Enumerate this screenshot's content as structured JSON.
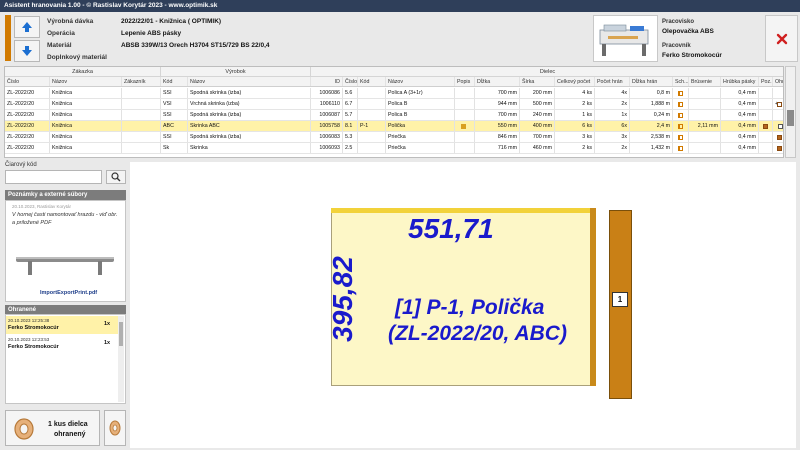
{
  "window": {
    "title": "Asistent hranovania 1.00 - © Rastislav Korytár 2023 - www.optimik.sk"
  },
  "info": {
    "labels": [
      "Výrobná dávka",
      "Operácia",
      "Materiál",
      "Doplnkový materiál"
    ],
    "values": [
      "2022/22/01 - Knižnica ( OPTIMIK)",
      "Lepenie ABS pásky",
      "ABSB 339W/13 Orech H3704 ST15/729 BS 22/0,4",
      ""
    ]
  },
  "workstation": {
    "station_label": "Pracovisko",
    "station_value": "Olepovačka ABS",
    "worker_label": "Pracovník",
    "worker_value": "Ferko Stromokocúr"
  },
  "table": {
    "groups": [
      "Zákazka",
      "Výrobok",
      "Dielec"
    ],
    "headers": [
      "Číslo",
      "Názov",
      "Zákazník",
      "Kód",
      "Názov",
      "ID",
      "Číslo",
      "Kód",
      "Názov",
      "Popis",
      "Dĺžka",
      "Šírka",
      "Celkový počet",
      "Počet hrán",
      "Dĺžka hrán",
      "Sch...",
      "Brúsenie",
      "Hrúbka pásky",
      "Poz...",
      "Ohr..."
    ],
    "rows": [
      [
        "ZL-2022/20",
        "Knižnica",
        "",
        "SSI",
        "Spodná skrinka (izba)",
        "1006086",
        "5.6",
        "",
        "Polica A (3+1r)",
        "",
        "700 mm",
        "200 mm",
        "4 ks",
        "4x",
        "0,8 m",
        "",
        "",
        "0,4 mm",
        "",
        ""
      ],
      [
        "ZL-2022/20",
        "Knižnica",
        "",
        "VSI",
        "Vrchná skrinka (izba)",
        "1006110",
        "6.7",
        "",
        "Polica B",
        "",
        "944 mm",
        "500 mm",
        "2 ks",
        "2x",
        "1,888 m",
        "",
        "",
        "0,4 mm",
        "",
        "+"
      ],
      [
        "ZL-2022/20",
        "Knižnica",
        "",
        "SSI",
        "Spodná skrinka (izba)",
        "1006087",
        "5.7",
        "",
        "Polica B",
        "",
        "700 mm",
        "240 mm",
        "1 ks",
        "1x",
        "0,24 m",
        "",
        "",
        "0,4 mm",
        "",
        ""
      ],
      [
        "ZL-2022/20",
        "Knižnica",
        "",
        "ABC",
        "Skrinka ABC",
        "1005758",
        "8.1",
        "P-1",
        "Polička",
        "",
        "550 mm",
        "400 mm",
        "6 ks",
        "6x",
        "2,4 m",
        "",
        "2,11 mm",
        "0,4 mm",
        "",
        ""
      ],
      [
        "ZL-2022/20",
        "Knižnica",
        "",
        "SSI",
        "Spodná skrinka (izba)",
        "1006083",
        "5.3",
        "",
        "Priečka",
        "",
        "846 mm",
        "700 mm",
        "3 ks",
        "3x",
        "2,538 m",
        "",
        "",
        "0,4 mm",
        "",
        ""
      ],
      [
        "ZL-2022/20",
        "Knižnica",
        "",
        "Sk",
        "Skrinka",
        "1006093",
        "2.5",
        "",
        "Priečka",
        "",
        "716 mm",
        "460 mm",
        "2 ks",
        "2x",
        "1,432 m",
        "",
        "",
        "0,4 mm",
        "",
        ""
      ]
    ],
    "selected_row": 3
  },
  "barcode": {
    "label": "Čiarový kód",
    "value": ""
  },
  "notes": {
    "title": "Poznámky a externé súbory",
    "meta": "20.10.2023, Rastislav Korytár",
    "text": "V hornej časti namontovať hrazdu - viď obr. a priložené PDF",
    "file": "ImportExportPrint.pdf"
  },
  "made": {
    "title": "Ohranené",
    "entries": [
      {
        "time": "20.10.2023 12:25:38",
        "name": "Ferko Stromokocúr",
        "count": "1x"
      },
      {
        "time": "20.10.2023 12:23:53",
        "name": "Ferko Stromokocúr",
        "count": "1x"
      }
    ]
  },
  "action": {
    "label_line1": "1 kus dielca",
    "label_line2": "ohranený"
  },
  "part_view": {
    "width": "551,71",
    "height": "395,82",
    "line1": "[1]  P-1, Polička",
    "line2": "(ZL-2022/20, ABC)",
    "side_label": "1"
  },
  "colors": {
    "titlebar": "#2f3f5a",
    "accent": "#d17a00",
    "dimension": "#1a1acc",
    "selection": "#fff2a8",
    "close": "#d02020"
  }
}
